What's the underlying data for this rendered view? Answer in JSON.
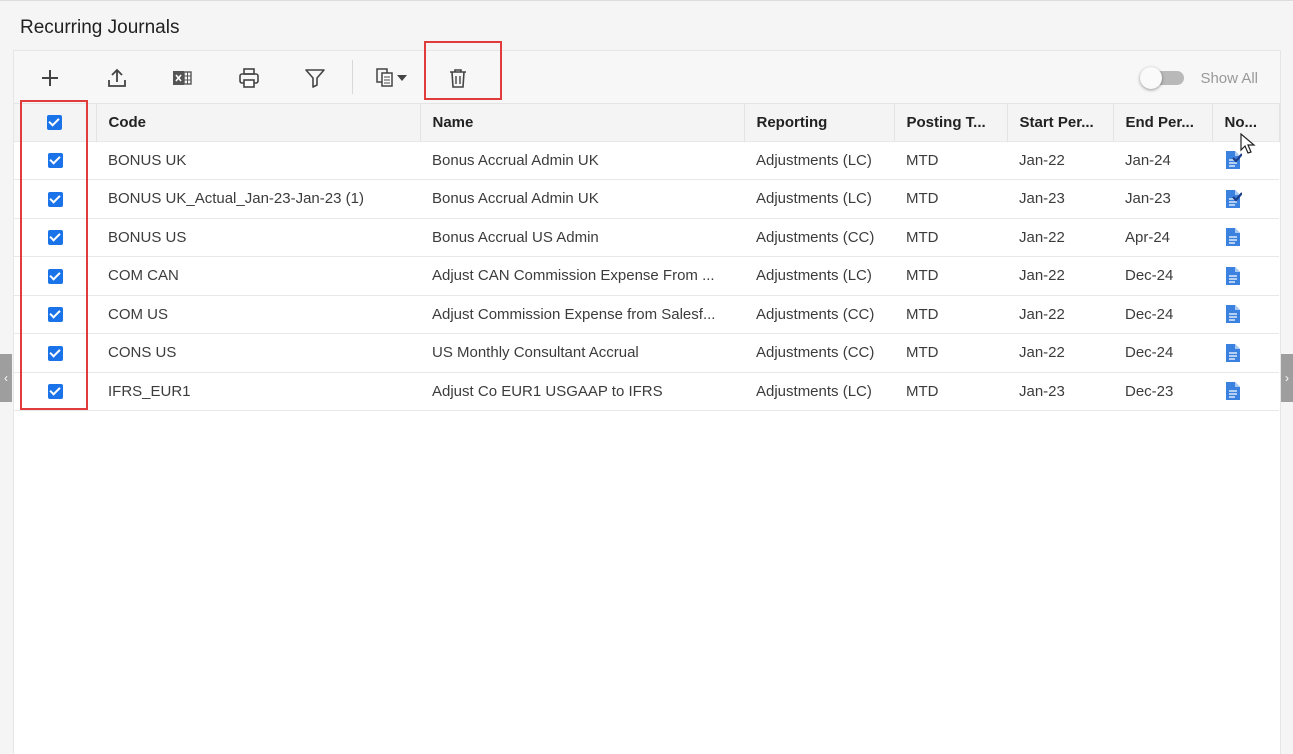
{
  "page": {
    "title": "Recurring Journals"
  },
  "toolbar": {
    "buttons": [
      {
        "name": "add-icon",
        "label": ""
      },
      {
        "name": "upload-icon",
        "label": ""
      },
      {
        "name": "excel-icon",
        "label": ""
      },
      {
        "name": "print-icon",
        "label": ""
      },
      {
        "name": "filter-icon",
        "label": ""
      },
      {
        "name": "copy-dropdown-icon",
        "label": ""
      },
      {
        "name": "delete-icon",
        "label": ""
      }
    ],
    "show_all_label": "Show All",
    "show_all_on": false
  },
  "table": {
    "columns": [
      "Code",
      "Name",
      "Reporting",
      "Posting T...",
      "Start Per...",
      "End Per...",
      "No..."
    ],
    "rows": [
      {
        "checked": true,
        "code": "BONUS UK",
        "name": "Bonus Accrual Admin UK",
        "reporting": "Adjustments (LC)",
        "posting": "MTD",
        "start": "Jan-22",
        "end": "Jan-24",
        "note": "note-checked-icon"
      },
      {
        "checked": true,
        "code": "BONUS UK_Actual_Jan-23-Jan-23 (1)",
        "name": "Bonus Accrual Admin UK",
        "reporting": "Adjustments (LC)",
        "posting": "MTD",
        "start": "Jan-23",
        "end": "Jan-23",
        "note": "note-checked-icon"
      },
      {
        "checked": true,
        "code": "BONUS US",
        "name": "Bonus Accrual US Admin",
        "reporting": "Adjustments (CC)",
        "posting": "MTD",
        "start": "Jan-22",
        "end": "Apr-24",
        "note": "note-icon"
      },
      {
        "checked": true,
        "code": "COM CAN",
        "name": "Adjust CAN Commission Expense From ...",
        "reporting": "Adjustments (LC)",
        "posting": "MTD",
        "start": "Jan-22",
        "end": "Dec-24",
        "note": "note-icon"
      },
      {
        "checked": true,
        "code": "COM US",
        "name": "Adjust Commission Expense from Salesf...",
        "reporting": "Adjustments (CC)",
        "posting": "MTD",
        "start": "Jan-22",
        "end": "Dec-24",
        "note": "note-icon"
      },
      {
        "checked": true,
        "code": "CONS US",
        "name": "US Monthly Consultant Accrual",
        "reporting": "Adjustments (CC)",
        "posting": "MTD",
        "start": "Jan-22",
        "end": "Dec-24",
        "note": "note-icon"
      },
      {
        "checked": true,
        "code": "IFRS_EUR1",
        "name": "Adjust Co EUR1 USGAAP to IFRS",
        "reporting": "Adjustments (LC)",
        "posting": "MTD",
        "start": "Jan-23",
        "end": "Dec-23",
        "note": "note-icon"
      }
    ]
  },
  "colors": {
    "accent": "#1a73e8",
    "highlight": "#e03c3c",
    "note_icon": "#3b82e0"
  }
}
